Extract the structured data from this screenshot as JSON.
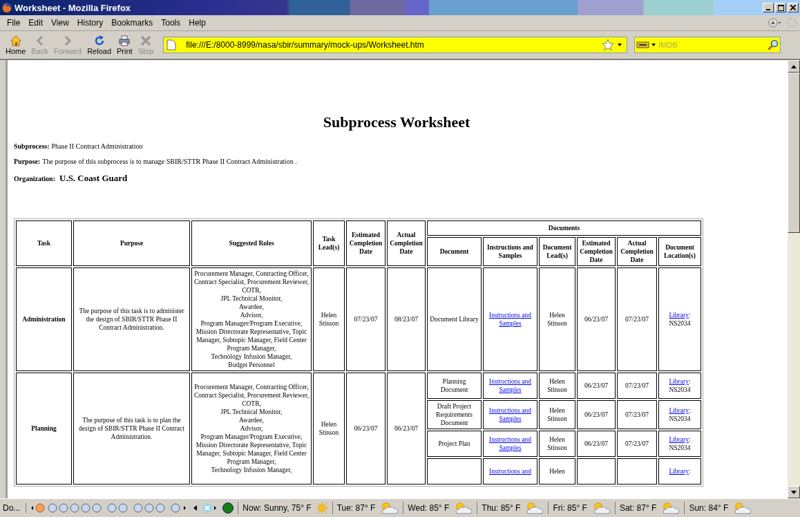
{
  "window": {
    "title": "Worksheet - Mozilla Firefox"
  },
  "menu": [
    "File",
    "Edit",
    "View",
    "History",
    "Bookmarks",
    "Tools",
    "Help"
  ],
  "toolbar": [
    {
      "kind": "home",
      "label": "Home",
      "disabled": false
    },
    {
      "kind": "back",
      "label": "Back",
      "disabled": true
    },
    {
      "kind": "forward",
      "label": "Forward",
      "disabled": true
    },
    {
      "kind": "reload",
      "label": "Reload",
      "disabled": false
    },
    {
      "kind": "print",
      "label": "Print",
      "disabled": false
    },
    {
      "kind": "stop",
      "label": "Stop",
      "disabled": true
    }
  ],
  "address": {
    "url": "file:///E:/8000-8999/nasa/sbir/summary/mock-ups/Worksheet.htm"
  },
  "search": {
    "placeholder": "IMDB"
  },
  "page": {
    "heading": "Subprocess Worksheet",
    "fields": [
      {
        "kind": "plain",
        "label": "Subprocess:",
        "value": "Phase II Contract Administration"
      },
      {
        "kind": "plain",
        "label": "Purpose:",
        "value": "The purpose of this subprocess is to manage SBIR/STTR Phase II Contract Administration ."
      },
      {
        "kind": "large",
        "label": "Organization:",
        "value": "U.S. Coast Guard"
      }
    ]
  },
  "table": {
    "columns": [
      "Task",
      "Purpose",
      "Suggested Roles",
      "Task Lead(s)",
      "Estimated Completion Date",
      "Actual Completion Date"
    ],
    "group": "Documents",
    "document_columns": [
      "Document",
      "Instructions and Samples",
      "Document Lead(s)",
      "Estimated Completion Date",
      "Actual Completion Date",
      "Document Location(s)"
    ],
    "rows": [
      {
        "task": "Administration",
        "purpose": "The purpose of this task is to administer the design of SBIR/STTR Phase II Contract Administration.",
        "roles": "Procurement Manager, Contracting Officer, Contract Specialist, Procurement Reviewer,\nCOTR,\nJPL Technical Monitor,\nAwardee,\nAdvisor,\nProgram Manager/Program Executive,\nMission Directorate Representative, Topic Manager, Subtopic Manager, Field Center Program Manager,\nTechnology Infusion Manager,\nBudget Personnel",
        "lead": "Helen Stinson",
        "estimated": "07/23/07",
        "actual": "08/23/07",
        "documents": [
          {
            "name": "Document Library",
            "instructions": "Instructions and Samples",
            "lead": "Helen Stinson",
            "estimated": "06/23/07",
            "actual": "07/23/07",
            "location_link": "Library",
            "location_rest": ": NS2034"
          }
        ]
      },
      {
        "task": "Planning",
        "purpose": "The purpose of this task is to plan the design of SBIR/STTR Phase II Contract Administration.",
        "roles": "Procurement Manager, Contracting Officer, Contract Specialist, Procurement Reviewer,\nCOTR,\nJPL Technical Monitor,\nAwardee,\nAdvisor,\nProgram Manager/Program Executive,\nMission Directorate Representative, Topic Manager, Subtopic Manager, Field Center Program Manager,\nTechnology Infusion Manager,",
        "lead": "Helen Stinson",
        "estimated": "06/23/07",
        "actual": "06/23/07",
        "documents": [
          {
            "name": "Planning Document",
            "instructions": "Instructions and Samples",
            "lead": "Helen Stinson",
            "estimated": "06/23/07",
            "actual": "07/23/07",
            "location_link": "Library",
            "location_rest": ": NS2034"
          },
          {
            "name": "Draft Project Requirements Document",
            "instructions": "Instructions and Samples",
            "lead": "Helen Stinson",
            "estimated": "06/23/07",
            "actual": "07/23/07",
            "location_link": "Library",
            "location_rest": ": NS2034"
          },
          {
            "name": "Project Plan",
            "instructions": "Instructions and Samples",
            "lead": "Helen Stinson",
            "estimated": "06/23/07",
            "actual": "07/23/07",
            "location_link": "Library",
            "location_rest": ": NS2034"
          },
          {
            "instructions": "Instructions and",
            "lead": "Helen",
            "location_link": "Library",
            "location_rest": ":"
          }
        ]
      }
    ]
  },
  "status_bar": {
    "text": "Do...",
    "weather": [
      {
        "kind": "sunny",
        "text": "Now: Sunny, 75° F"
      },
      {
        "kind": "partly-cloudy",
        "text": "Tue: 87° F"
      },
      {
        "kind": "partly-cloudy",
        "text": "Wed: 85° F"
      },
      {
        "kind": "partly-cloudy",
        "text": "Thu: 85° F"
      },
      {
        "kind": "partly-cloudy",
        "text": "Fri: 85° F"
      },
      {
        "kind": "partly-cloudy",
        "text": "Sat: 87° F"
      },
      {
        "kind": "partly-cloudy",
        "text": "Sun: 84° F"
      }
    ]
  }
}
